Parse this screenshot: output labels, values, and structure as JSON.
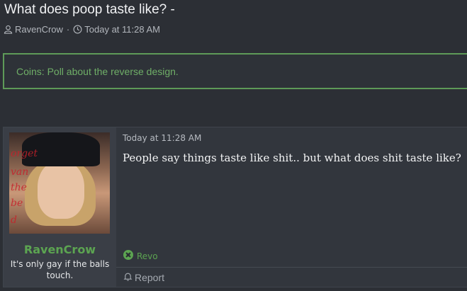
{
  "thread": {
    "title": "What does poop taste like? -",
    "author": "RavenCrow",
    "separator": "·",
    "time": "Today at 11:28 AM"
  },
  "notice": {
    "text": "Coins: Poll about the reverse design."
  },
  "post": {
    "username": "RavenCrow",
    "user_title": "It's only gay if the balls touch.",
    "date": "Today at 11:28 AM",
    "body": "People say things taste like shit.. but what does shit taste like?",
    "reaction_user": "Revo",
    "report_label": "Report",
    "avatar_caption": [
      "orget",
      "van",
      "the",
      "be",
      "d"
    ]
  },
  "icons": {
    "user": "user-icon",
    "clock": "clock-icon",
    "reaction": "reaction-icon",
    "report": "bell-icon"
  },
  "colors": {
    "background": "#2c2f35",
    "accent_green": "#5ca451",
    "notice_border": "#5e9a58"
  }
}
